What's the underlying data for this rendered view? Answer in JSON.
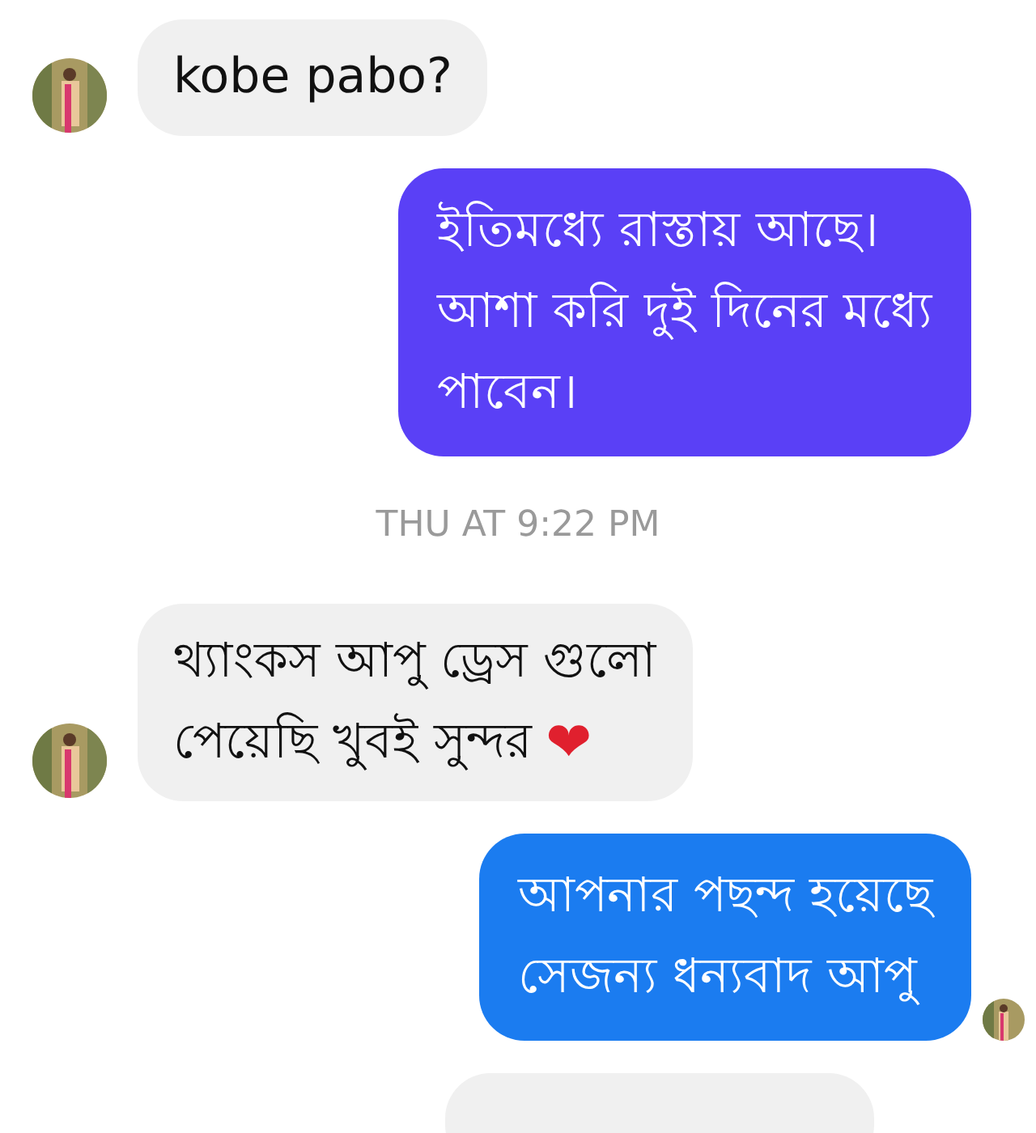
{
  "messages": [
    {
      "kind": "received",
      "avatar": true,
      "lines": [
        "kobe pabo?"
      ]
    },
    {
      "kind": "sent",
      "avatar": false,
      "color": "#5a40f6",
      "lines": [
        "ইতিমধ্যে রাস্তায় আছে।",
        "আশা করি দুই দিনের মধ্যে",
        "পাবেন।"
      ]
    },
    {
      "kind": "timestamp",
      "lines": [
        "THU AT 9:22 PM"
      ]
    },
    {
      "kind": "received",
      "avatar": true,
      "lines": [
        "থ্যাংকস আপু ড্রেস গুলো",
        "পেয়েছি খুবই সুন্দর"
      ],
      "trailing": "❤"
    },
    {
      "kind": "sent",
      "avatar": true,
      "color": "#1b7cf0",
      "lines": [
        "আপনার পছন্দ হয়েছে",
        "সেজন্য ধন্যবাদ আপু"
      ]
    },
    {
      "kind": "partial"
    }
  ]
}
